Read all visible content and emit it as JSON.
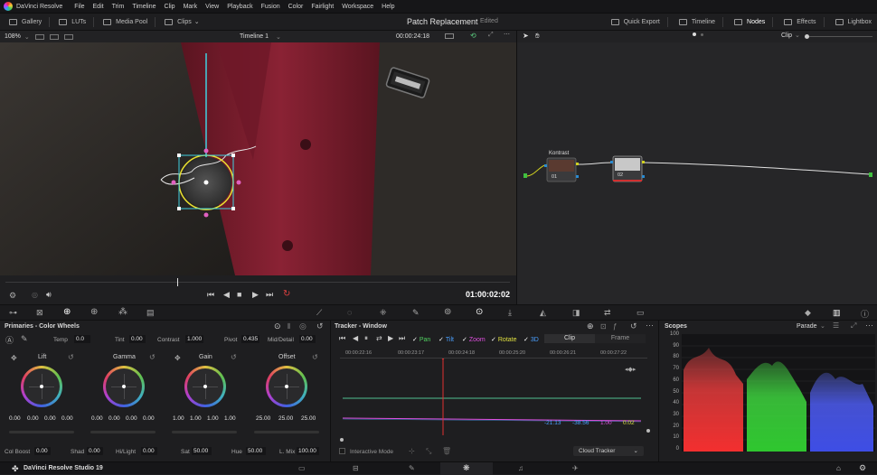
{
  "app": {
    "name": "DaVinci Resolve",
    "status_name": "DaVinci Resolve Studio 19"
  },
  "menu": [
    "File",
    "Edit",
    "Trim",
    "Timeline",
    "Clip",
    "Mark",
    "View",
    "Playback",
    "Fusion",
    "Color",
    "Fairlight",
    "Workspace",
    "Help"
  ],
  "toolbar": {
    "left": [
      "Gallery",
      "LUTs",
      "Media Pool",
      "Clips"
    ],
    "project_title": "Patch Replacement",
    "project_status": "Edited",
    "right": [
      "Quick Export",
      "Timeline",
      "Nodes",
      "Effects",
      "Lightbox"
    ]
  },
  "viewer": {
    "zoom": "108%",
    "timeline_name": "Timeline 1",
    "timecode_top": "00:00:24:18",
    "timecode": "01:00:02:02"
  },
  "nodes": {
    "mode": "Clip",
    "node1_label": "Kontrast",
    "node1_num": "01",
    "node2_num": "02"
  },
  "primaries": {
    "title": "Primaries - Color Wheels",
    "temp_label": "Temp",
    "temp": "0.0",
    "tint_label": "Tint",
    "tint": "0.00",
    "contrast_label": "Contrast",
    "contrast": "1.000",
    "pivot_label": "Pivot",
    "pivot": "0.435",
    "middetail_label": "Mid/Detail",
    "middetail": "0.00",
    "wheels": [
      {
        "name": "Lift",
        "values": [
          "0.00",
          "0.00",
          "0.00",
          "0.00"
        ]
      },
      {
        "name": "Gamma",
        "values": [
          "0.00",
          "0.00",
          "0.00",
          "0.00"
        ]
      },
      {
        "name": "Gain",
        "values": [
          "1.00",
          "1.00",
          "1.00",
          "1.00"
        ]
      },
      {
        "name": "Offset",
        "values": [
          "25.00",
          "25.00",
          "25.00"
        ]
      }
    ],
    "colboost_label": "Col Boost",
    "colboost": "0.00",
    "shad_label": "Shad",
    "shad": "0.00",
    "hilight_label": "Hi/Light",
    "hilight": "0.00",
    "sat_label": "Sat",
    "sat": "50.00",
    "hue_label": "Hue",
    "hue": "50.00",
    "lmix_label": "L. Mix",
    "lmix": "100.00"
  },
  "tracker": {
    "title": "Tracker - Window",
    "options": [
      "Pan",
      "Tilt",
      "Zoom",
      "Rotate",
      "3D"
    ],
    "option_colors": [
      "#50d060",
      "#4aa0ff",
      "#e050e0",
      "#e0e040",
      "#4aa0ff"
    ],
    "clip_label": "Clip",
    "frame_label": "Frame",
    "ruler": [
      "00:00:22:16",
      "00:00:23:17",
      "00:00:24:18",
      "00:00:25:20",
      "00:00:26:21",
      "00:00:27:22"
    ],
    "readouts": [
      "-21.13",
      "-38.56",
      "1.00",
      "0.02"
    ],
    "readout_colors": [
      "#4aa0ff",
      "#4aa0ff",
      "#e050e0",
      "#e0e040"
    ],
    "interactive_mode": "Interactive Mode",
    "cloud_tracker": "Cloud Tracker"
  },
  "scopes": {
    "title": "Scopes",
    "mode": "Parade",
    "scale": [
      "100",
      "90",
      "80",
      "70",
      "60",
      "50",
      "40",
      "30",
      "20",
      "10",
      "0"
    ]
  }
}
